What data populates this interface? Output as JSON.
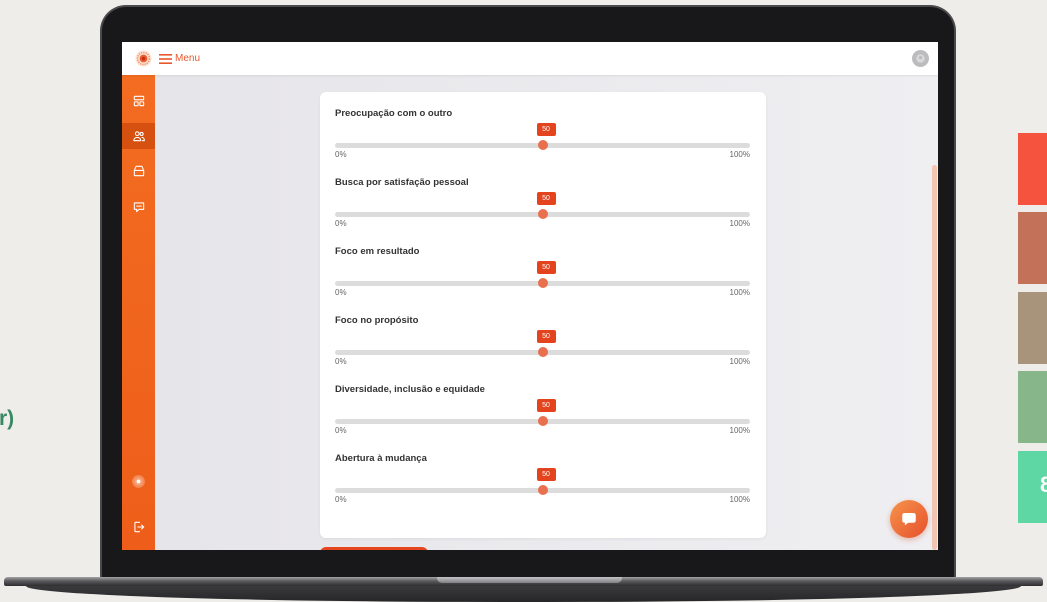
{
  "topbar": {
    "logo_icon": "brand-logo-icon",
    "menu_icon": "hamburger-icon",
    "menu_label": "Menu",
    "avatar_icon": "avatar-icon"
  },
  "sidebar": {
    "items": [
      {
        "icon": "dashboard-icon",
        "active": false
      },
      {
        "icon": "users-icon",
        "active": true
      },
      {
        "icon": "archive-icon",
        "active": false
      },
      {
        "icon": "chat-icon",
        "active": false
      }
    ],
    "footer": [
      {
        "icon": "brand-logo-icon"
      },
      {
        "icon": "logout-icon"
      }
    ]
  },
  "form": {
    "sliders": [
      {
        "label": "Preocupação com o outro",
        "value": 50,
        "min_label": "0%",
        "max_label": "100%"
      },
      {
        "label": "Busca por satisfação pessoal",
        "value": 50,
        "min_label": "0%",
        "max_label": "100%"
      },
      {
        "label": "Foco em resultado",
        "value": 50,
        "min_label": "0%",
        "max_label": "100%"
      },
      {
        "label": "Foco no propósito",
        "value": 50,
        "min_label": "0%",
        "max_label": "100%"
      },
      {
        "label": "Diversidade, inclusão e equidade",
        "value": 50,
        "min_label": "0%",
        "max_label": "100%"
      },
      {
        "label": "Abertura à mudança",
        "value": 50,
        "min_label": "0%",
        "max_label": "100%"
      }
    ]
  },
  "chat_button": {
    "icon": "chat-bubble-icon"
  },
  "backdrop": {
    "left_text": "r)",
    "swatches": [
      {
        "color": "#f5533e"
      },
      {
        "color": "#c4715a"
      },
      {
        "color": "#a7947a"
      },
      {
        "color": "#88b68b"
      },
      {
        "color": "#5ed7a5",
        "text": "8"
      }
    ]
  },
  "colors": {
    "accent": "#f06523",
    "badge": "#e3441e",
    "thumb": "#e8704e",
    "track": "#dcdcdc"
  }
}
